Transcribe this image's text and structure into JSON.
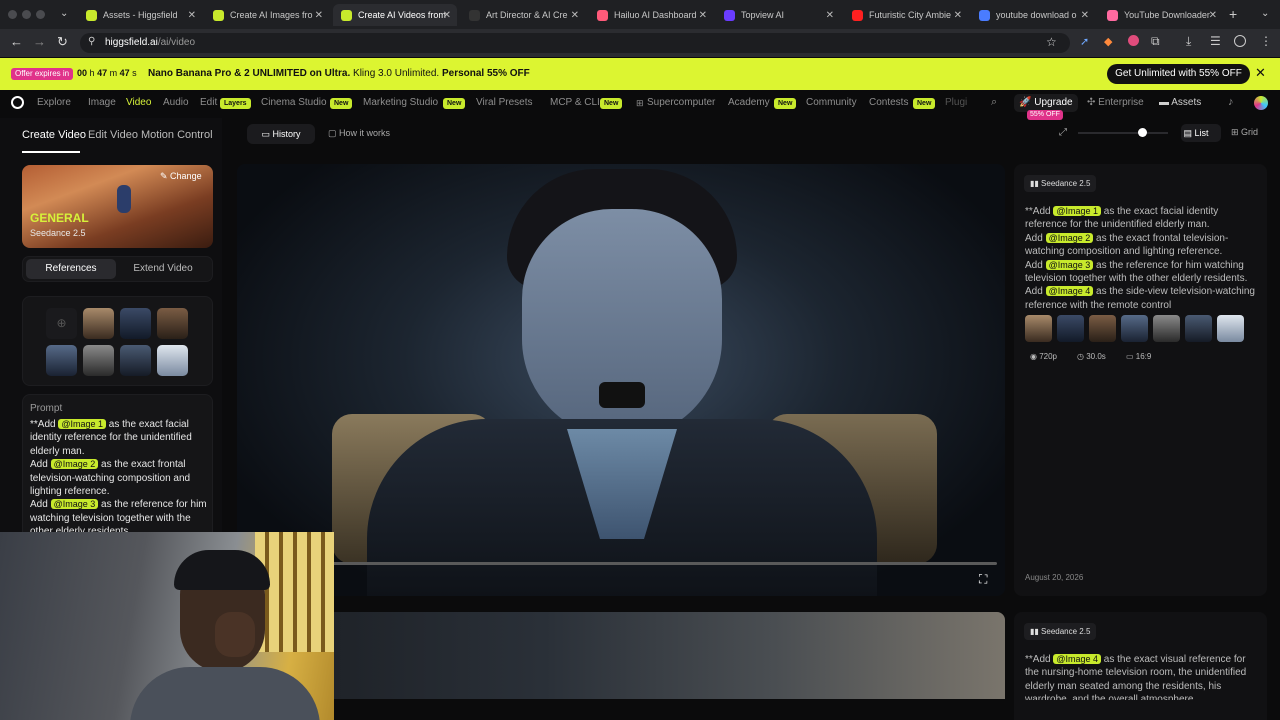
{
  "browser": {
    "tabs": [
      {
        "title": "Assets - Higgsfield",
        "color": "#c8ea2c"
      },
      {
        "title": "Create AI Images fro",
        "color": "#c8ea2c"
      },
      {
        "title": "Create AI Videos from",
        "color": "#c8ea2c",
        "active": true
      },
      {
        "title": "Art Director & AI Cre",
        "color": "#333"
      },
      {
        "title": "Hailuo AI Dashboard",
        "color": "#ff5a7a"
      },
      {
        "title": "Topview AI",
        "color": "#6a3cff"
      },
      {
        "title": "Futuristic City Ambie",
        "color": "#ff2020"
      },
      {
        "title": "youtube download o",
        "color": "#4a7cff"
      },
      {
        "title": "YouTube Downloader",
        "color": "#ff6aa0"
      }
    ],
    "url_host": "higgsfield.ai",
    "url_path": "/ai/video"
  },
  "promo": {
    "expires_label": "Offer expires in",
    "timer": {
      "h": "00",
      "h_unit": "h",
      "m": "47",
      "m_unit": "m",
      "s": "47",
      "s_unit": "s"
    },
    "text_bold": "Nano Banana Pro & 2 UNLIMITED on Ultra.",
    "text_normal": "Kling 3.0 Unlimited.",
    "text_bold2": "Personal 55% OFF",
    "cta": "Get Unlimited with 55% OFF"
  },
  "nav": {
    "items": [
      "Explore",
      "Image",
      "Video",
      "Audio",
      "Edit",
      "Cinema Studio",
      "Marketing Studio",
      "Viral Presets",
      "MCP & CLI",
      "Supercomputer",
      "Academy",
      "Community",
      "Contests",
      "Plugi"
    ],
    "badge_layers": "Layers",
    "badge_new": "New",
    "upgrade": "Upgrade",
    "upgrade_badge": "55% OFF",
    "enterprise": "Enterprise",
    "assets": "Assets"
  },
  "left": {
    "tabs": [
      "Create Video",
      "Edit Video",
      "Motion Control"
    ],
    "model_card": {
      "change": "Change",
      "title": "GENERAL",
      "model": "Seedance 2.5"
    },
    "toggle": [
      "References",
      "Extend Video"
    ],
    "prompt_label": "Prompt",
    "prompt_lines": [
      {
        "pre": "**Add ",
        "tag": "@Image 1",
        "post": " as the exact facial"
      },
      {
        "pre": "identity reference for the unidentified",
        "tag": "",
        "post": ""
      },
      {
        "pre": "elderly man.",
        "tag": "",
        "post": ""
      },
      {
        "pre": "Add ",
        "tag": "@Image 2",
        "post": " as the exact frontal"
      },
      {
        "pre": "television-watching composition and",
        "tag": "",
        "post": ""
      },
      {
        "pre": "lighting reference.",
        "tag": "",
        "post": ""
      },
      {
        "pre": "Add ",
        "tag": "@Image 3",
        "post": " as the reference for him"
      },
      {
        "pre": "watching television together with the",
        "tag": "",
        "post": ""
      },
      {
        "pre": "other elderly residents",
        "tag": "",
        "post": ""
      }
    ]
  },
  "center": {
    "history": "History",
    "how": "How it works",
    "view_list": "List",
    "view_grid": "Grid"
  },
  "right": {
    "card1": {
      "model": "Seedance 2.5",
      "lines": [
        {
          "pre": "**Add ",
          "tag": "@Image 1",
          "post": " as the exact facial identity"
        },
        {
          "pre": "reference for the unidentified elderly man.",
          "tag": "",
          "post": ""
        },
        {
          "pre": "Add ",
          "tag": "@Image 2",
          "post": " as the exact frontal television-"
        },
        {
          "pre": "watching composition and lighting reference.",
          "tag": "",
          "post": ""
        },
        {
          "pre": "Add ",
          "tag": "@Image 3",
          "post": " as the reference for him watching"
        },
        {
          "pre": "television together with the other elderly residents.",
          "tag": "",
          "post": ""
        },
        {
          "pre": "Add ",
          "tag": "@Image 4",
          "post": " as the side-view television-watching"
        },
        {
          "pre": "reference with the remote control",
          "tag": "",
          "post": ""
        }
      ],
      "resolution": "720p",
      "duration": "30.0s",
      "ratio": "16:9",
      "date": "August 20, 2026"
    },
    "card2": {
      "model": "Seedance 2.5",
      "lines": [
        {
          "pre": "**Add ",
          "tag": "@Image 4",
          "post": " as the exact visual reference for"
        },
        {
          "pre": "the nursing-home television room, the unidentified",
          "tag": "",
          "post": ""
        },
        {
          "pre": "elderly man seated among the residents, his",
          "tag": "",
          "post": ""
        },
        {
          "pre": "wardrobe, and the overall atmosphere",
          "tag": "",
          "post": ""
        }
      ]
    }
  },
  "colors": {
    "accent": "#d7f23a",
    "badge": "#c8ea2c",
    "promo_bg": "#dcf531",
    "upgrade_badge": "#e0338a"
  }
}
